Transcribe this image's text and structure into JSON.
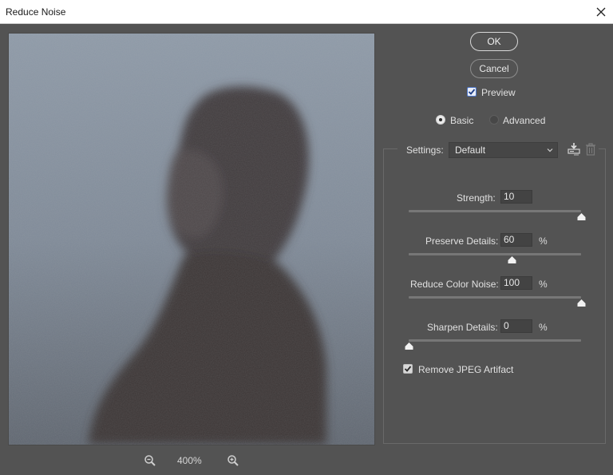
{
  "window": {
    "title": "Reduce Noise",
    "close_icon": "close-icon"
  },
  "preview": {
    "zoom_level": "400%",
    "zoom_out_icon": "zoom-out-icon",
    "zoom_in_icon": "zoom-in-icon",
    "image_description": "Noisy portrait of person in profile against grey-blue background"
  },
  "buttons": {
    "ok": "OK",
    "cancel": "Cancel"
  },
  "preview_toggle": {
    "label": "Preview",
    "checked": true
  },
  "mode": {
    "options": [
      "Basic",
      "Advanced"
    ],
    "selected": "Basic"
  },
  "settings": {
    "label": "Settings:",
    "value": "Default",
    "save_icon": "save-preset-icon",
    "delete_icon": "trash-icon"
  },
  "sliders": [
    {
      "label": "Strength:",
      "value": "10",
      "unit": "",
      "min": 0,
      "max": 10,
      "fraction": 1.0
    },
    {
      "label": "Preserve Details:",
      "value": "60",
      "unit": "%",
      "min": 0,
      "max": 100,
      "fraction": 0.6
    },
    {
      "label": "Reduce Color Noise:",
      "value": "100",
      "unit": "%",
      "min": 0,
      "max": 100,
      "fraction": 1.0
    },
    {
      "label": "Sharpen Details:",
      "value": "0",
      "unit": "%",
      "min": 0,
      "max": 100,
      "fraction": 0.0
    }
  ],
  "jpeg_artifact": {
    "label": "Remove JPEG Artifact",
    "checked": true
  }
}
